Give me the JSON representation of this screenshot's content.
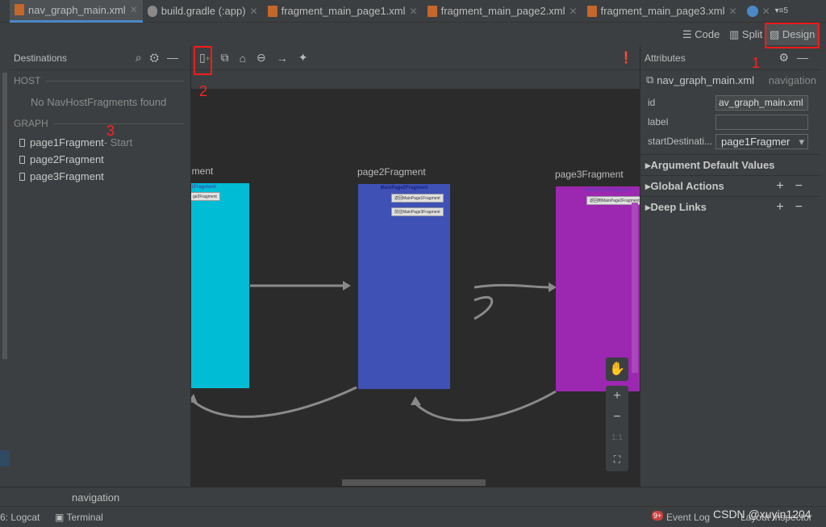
{
  "tabs": [
    {
      "label": "nav_graph_main.xml",
      "active": true
    },
    {
      "label": "build.gradle (:app)"
    },
    {
      "label": "fragment_main_page1.xml"
    },
    {
      "label": "fragment_main_page2.xml"
    },
    {
      "label": "fragment_main_page3.xml"
    }
  ],
  "tab_overflow": "5",
  "view_modes": {
    "code": "Code",
    "split": "Split",
    "design": "Design"
  },
  "destinations": {
    "title": "Destinations",
    "host_header": "HOST",
    "host_empty": "No NavHostFragments found",
    "graph_header": "GRAPH",
    "items": [
      {
        "label": "page1Fragment",
        "suffix": " - Start"
      },
      {
        "label": "page2Fragment"
      },
      {
        "label": "page3Fragment"
      }
    ]
  },
  "attributes": {
    "title": "Attributes",
    "file": "nav_graph_main.xml",
    "type": "navigation",
    "fields": [
      {
        "label": "id",
        "value": "av_graph_main.xml"
      },
      {
        "label": "label",
        "value": ""
      },
      {
        "label": "startDestinati...",
        "value": "page1Fragmer"
      }
    ],
    "groups": [
      "Argument Default Values",
      "Global Actions",
      "Deep Links"
    ]
  },
  "canvas": {
    "fragments": [
      {
        "label": "gment",
        "title": "1Fragment",
        "buttons": [
          "ge2Fragment"
        ],
        "color": "#00bcd4"
      },
      {
        "label": "page2Fragment",
        "title": "MainPage2Fragment",
        "buttons": [
          "返回MainPage1Fragment",
          "前往MainPage3Fragment"
        ],
        "color": "#3f51b5"
      },
      {
        "label": "page3Fragment",
        "title": "MainPage3Fragment",
        "buttons": [
          "返回到MainPage2Fragment"
        ],
        "color": "#9c27b0"
      }
    ],
    "zoom_one": "1:1"
  },
  "bottom_tab": "navigation",
  "status": {
    "logcat": "6: Logcat",
    "terminal": "Terminal",
    "event_log": "Event Log",
    "event_badge": "9+",
    "layout_inspector": "Layout Inspector",
    "watermark": "CSDN @xuyin1204"
  },
  "annotations": [
    "1",
    "2",
    "3"
  ],
  "colors": {
    "annotation": "#ff1a1a",
    "accent": "#4a88c7"
  }
}
